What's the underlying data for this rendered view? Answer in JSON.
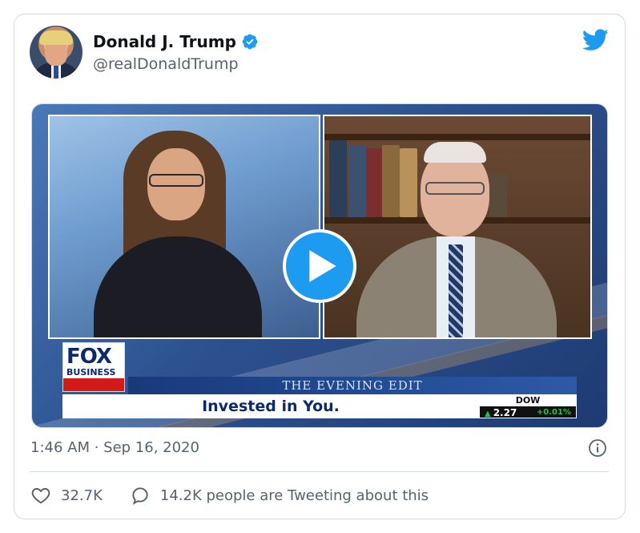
{
  "tweet": {
    "author_name": "Donald J. Trump",
    "handle": "@realDonaldTrump",
    "timestamp": "1:46 AM · Sep 16, 2020"
  },
  "media": {
    "network_logo_top": "FOX",
    "network_logo_bottom": "BUSINESS",
    "show_title": "THE EVENING EDIT",
    "headline": "Invested in You.",
    "ticker": {
      "label": "DOW",
      "value": "2.27",
      "change": "+0.01%"
    }
  },
  "actions": {
    "likes": "32.7K",
    "conversation": "14.2K people are Tweeting about this"
  },
  "icons": {
    "verified": "verified-badge-icon",
    "brand": "twitter-bird-icon",
    "play": "play-icon",
    "info": "info-icon",
    "like": "heart-icon",
    "reply": "speech-bubble-icon"
  },
  "colors": {
    "accent": "#1d9bf0",
    "text_primary": "#0f1419",
    "text_secondary": "#536471",
    "border": "#cfd9de"
  }
}
